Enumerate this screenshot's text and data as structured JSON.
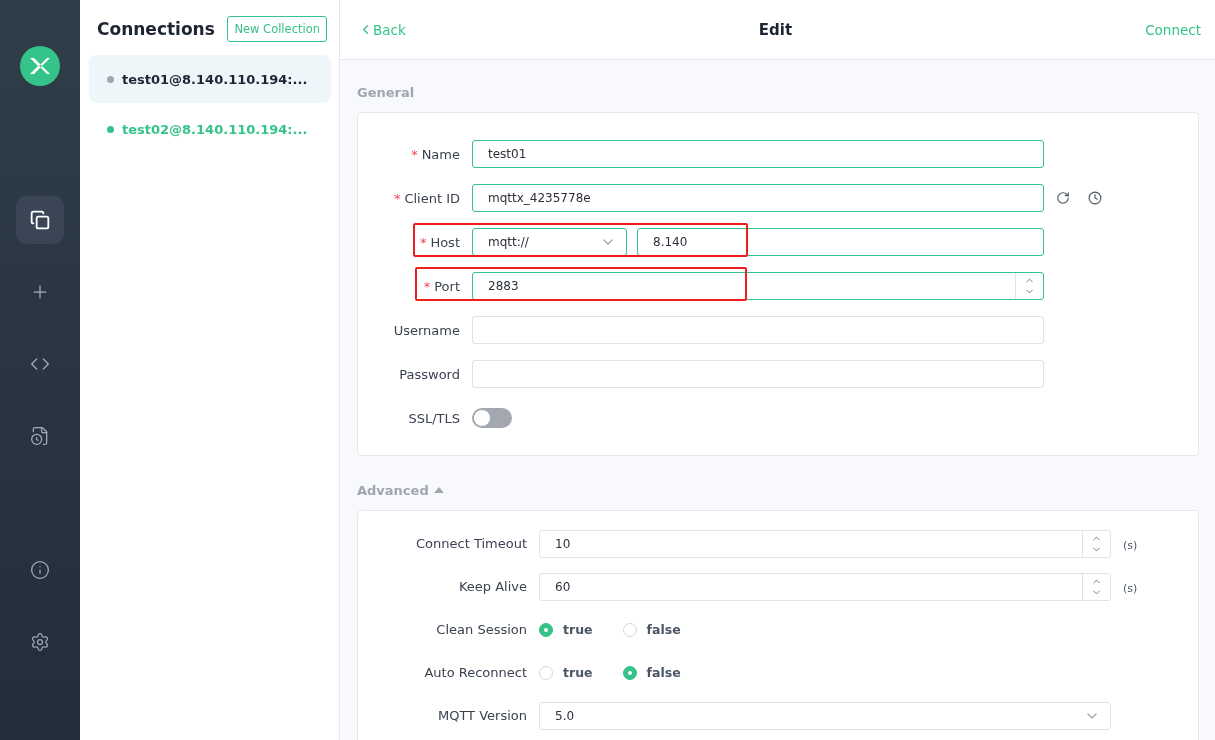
{
  "nav": [
    {
      "kind": "connections",
      "selected": true
    },
    {
      "kind": "new",
      "selected": false
    },
    {
      "kind": "script",
      "selected": false
    },
    {
      "kind": "log",
      "selected": false
    }
  ],
  "nav_bottom": [
    {
      "kind": "about"
    },
    {
      "kind": "settings"
    }
  ],
  "connections_panel": {
    "title": "Connections",
    "new_button": "New Collection",
    "items": [
      {
        "name": "test01@8.140.110.194:...",
        "color": "#a2a7b3",
        "connected": false,
        "selected": true
      },
      {
        "name": "test02@8.140.110.194:...",
        "color": "#34c388",
        "connected": true,
        "selected": false
      }
    ]
  },
  "header": {
    "back": "Back",
    "title": "Edit",
    "action": "Connect"
  },
  "general": {
    "title": "General",
    "fields": [
      {
        "kind": "text",
        "required_mark": "*",
        "label": "Name",
        "value": "test01",
        "highlighted": false
      },
      {
        "kind": "client",
        "required_mark": "*",
        "label": "Client ID",
        "value": "mqttx_4235778e",
        "highlighted": false
      },
      {
        "kind": "host",
        "required_mark": "*",
        "label": "Host",
        "protocol": "mqtt://",
        "value": "8.140",
        "highlighted": true
      },
      {
        "kind": "number",
        "required_mark": "*",
        "label": "Port",
        "value": "2883",
        "highlighted": true
      },
      {
        "kind": "text",
        "label": "Username",
        "highlighted": false
      },
      {
        "kind": "text",
        "label": "Password",
        "highlighted": false
      },
      {
        "kind": "switch",
        "label": "SSL/TLS",
        "on": false,
        "highlighted": false
      }
    ]
  },
  "advanced": {
    "title": "Advanced",
    "expanded": true,
    "fields": [
      {
        "kind": "number",
        "label": "Connect Timeout",
        "value": "10",
        "unit": "(s)"
      },
      {
        "kind": "number",
        "label": "Keep Alive",
        "value": "60",
        "unit": "(s)"
      },
      {
        "kind": "radio",
        "label": "Clean Session",
        "options": [
          {
            "label": "true",
            "selected": true
          },
          {
            "label": "false",
            "selected": false
          }
        ]
      },
      {
        "kind": "radio",
        "label": "Auto Reconnect",
        "options": [
          {
            "label": "true",
            "selected": false
          },
          {
            "label": "false",
            "selected": true
          }
        ]
      },
      {
        "kind": "select",
        "label": "MQTT Version",
        "value": "5.0"
      }
    ]
  }
}
